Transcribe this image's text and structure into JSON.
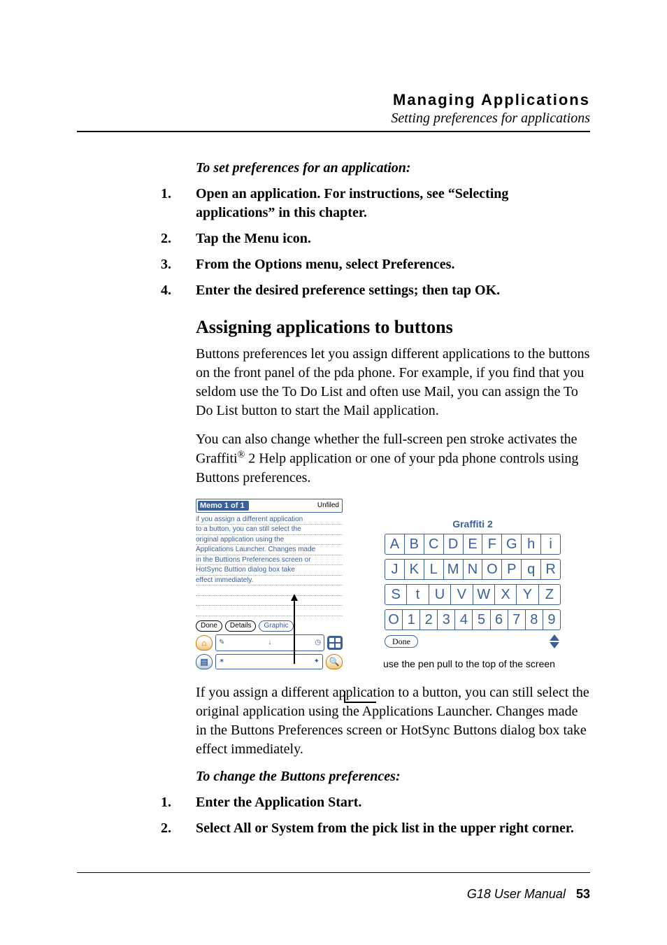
{
  "header": {
    "title": "Managing Applications",
    "subtitle": "Setting preferences for applications"
  },
  "section1": {
    "lead": "To set preferences for an application:",
    "steps": [
      "Open an application. For instructions, see “Selecting applications” in this chapter.",
      "Tap the Menu icon.",
      "From the Options menu, select Preferences.",
      "Enter the desired preference settings; then tap OK."
    ]
  },
  "section2": {
    "heading": "Assigning applications to buttons",
    "para1": "Buttons preferences let you assign different applications to the buttons on the front panel of the pda phone. For example, if you find that you seldom use the To Do List and often use Mail, you can assign the To Do List button to start the Mail application.",
    "para2_pre": "You can also change whether the full-screen pen stroke activates the Graffiti",
    "para2_post": " 2 Help application or one of your pda phone controls using Buttons preferences.",
    "registered": "®",
    "figure": {
      "memo": {
        "title": "Memo 1 of 1",
        "category": "Unfiled",
        "lines": [
          "if you assign a different application",
          "to a button, you can still select the",
          "original application using the",
          "Applications Launcher. Changes made",
          "in the Buttions Preferences screen or",
          "HotSync Buttion dialog box take",
          "effect immediately."
        ],
        "buttons": {
          "done": "Done",
          "details": "Details",
          "graphic": "Graphic"
        },
        "icons": {
          "home": "home-icon",
          "menu": "menu-icon",
          "find": "find-icon",
          "apps": "apps-icon"
        }
      },
      "graffiti": {
        "title": "Graffiti 2",
        "rows": [
          [
            "A",
            "B",
            "C",
            "D",
            "E",
            "F",
            "G",
            "h",
            "i"
          ],
          [
            "J",
            "K",
            "L",
            "M",
            "N",
            "O",
            "P",
            "q",
            "R"
          ],
          [
            "S",
            "t",
            "U",
            "V",
            "W",
            "X",
            "Y",
            "Z"
          ],
          [
            "O",
            "1",
            "2",
            "3",
            "4",
            "5",
            "6",
            "7",
            "8",
            "9"
          ]
        ],
        "done": "Done"
      },
      "caption": "use the pen pull to the top of the screen"
    },
    "para3": "If you assign a different application to a button, you can still select the original application using the Applications Launcher. Changes made in the Buttons Preferences screen or HotSync Buttons dialog box take effect immediately.",
    "lead2": "To change the Buttons preferences:",
    "steps2": [
      "Enter the Application Start.",
      "Select All or System from the pick list in the upper right corner."
    ]
  },
  "footer": {
    "manual": "G18 User Manual",
    "page": "53"
  }
}
